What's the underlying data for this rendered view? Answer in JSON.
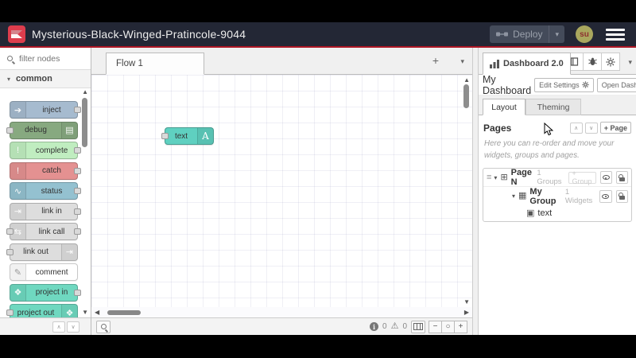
{
  "header": {
    "title": "Mysterious-Black-Winged-Pratincole-9044",
    "deploy_label": "Deploy",
    "avatar_initials": "su"
  },
  "palette": {
    "search_placeholder": "filter nodes",
    "category_label": "common",
    "nodes": [
      {
        "id": "inject",
        "label": "inject",
        "color": "#a6bbcf",
        "icon": "➔",
        "icon_side": "left",
        "ports": "out"
      },
      {
        "id": "debug",
        "label": "debug",
        "color": "#87a980",
        "icon": "▤",
        "icon_side": "right",
        "ports": "in"
      },
      {
        "id": "complete",
        "label": "complete",
        "color": "#c0edc0",
        "icon": "!",
        "icon_side": "left",
        "ports": "out"
      },
      {
        "id": "catch",
        "label": "catch",
        "color": "#e49191",
        "icon": "!",
        "icon_side": "left",
        "ports": "out"
      },
      {
        "id": "status",
        "label": "status",
        "color": "#94c1d0",
        "icon": "∿",
        "icon_side": "left",
        "ports": "out"
      },
      {
        "id": "link-in",
        "label": "link in",
        "color": "#dddddd",
        "icon": "⇥",
        "icon_side": "left",
        "ports": "out"
      },
      {
        "id": "link-call",
        "label": "link call",
        "color": "#dddddd",
        "icon": "⇆",
        "icon_side": "left",
        "ports": "both"
      },
      {
        "id": "link-out",
        "label": "link out",
        "color": "#dddddd",
        "icon": "⇥",
        "icon_side": "right",
        "ports": "in"
      },
      {
        "id": "comment",
        "label": "comment",
        "color": "#ffffff",
        "icon": "✎",
        "icon_color": "#999999",
        "icon_side": "left",
        "ports": "none"
      },
      {
        "id": "project-in",
        "label": "project in",
        "color": "#6fd8c0",
        "icon": "❖",
        "icon_side": "left",
        "ports": "out"
      },
      {
        "id": "project-out",
        "label": "project out",
        "color": "#6fd8c0",
        "icon": "❖",
        "icon_side": "right",
        "ports": "in"
      }
    ]
  },
  "workspace": {
    "tab_label": "Flow 1"
  },
  "canvas": {
    "node": {
      "label": "text",
      "icon_letter": "A",
      "color": "#5fd0c0"
    }
  },
  "canvas_footer": {
    "info_count": "0",
    "warn_count": "0",
    "zoom_out": "−",
    "zoom_reset": "○",
    "zoom_in": "+"
  },
  "sidebar": {
    "tab_label": "Dashboard 2.0",
    "dashboard_title": "My Dashboard",
    "edit_settings_label": "Edit Settings",
    "open_dashboard_label": "Open Dashboard",
    "layout_tab": "Layout",
    "theming_tab": "Theming",
    "pages": {
      "heading": "Pages",
      "add_page_label": "+ Page",
      "help_text": "Here you can re-order and move your widgets, groups and pages.",
      "tree": {
        "page_name": "Page N",
        "page_meta": "1 Groups",
        "add_group_label": "+ Group",
        "group_name": "My Group",
        "group_meta": "1 Widgets",
        "widget_label": "text"
      }
    }
  },
  "colors": {
    "header_bg": "#232735",
    "accent_red": "#ad1625",
    "dashboard_teal": "#5fd0c0"
  }
}
